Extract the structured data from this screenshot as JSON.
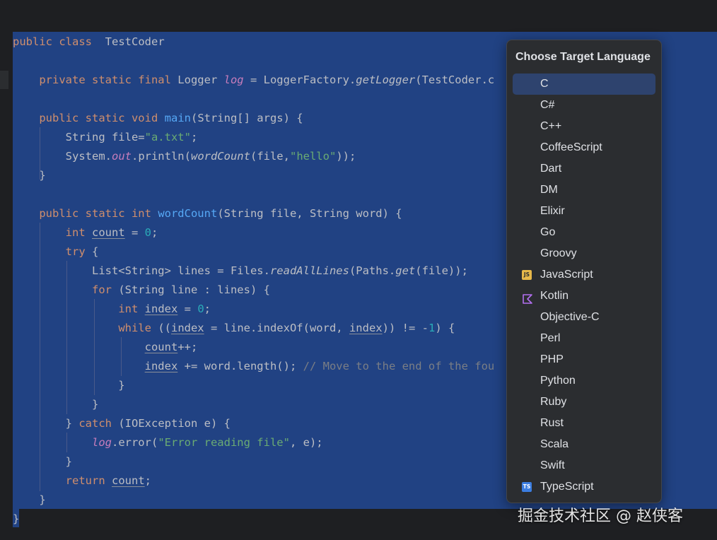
{
  "editor": {
    "code_lines": [
      "public class TestCoder {",
      "",
      "    private static final Logger log = LoggerFactory.getLogger(TestCoder.c",
      "",
      "    public static void main(String[] args) {",
      "        String file=\"a.txt\";",
      "        System.out.println(wordCount(file,\"hello\"));",
      "    }",
      "",
      "    public static int wordCount(String file, String word) {",
      "        int count = 0;",
      "        try {",
      "            List<String> lines = Files.readAllLines(Paths.get(file));",
      "            for (String line : lines) {",
      "                int index = 0;",
      "                while ((index = line.indexOf(word, index)) != -1) {",
      "                    count++;",
      "                    index += word.length(); // Move to the end of the fou",
      "                }",
      "            }",
      "        } catch (IOException e) {",
      "            log.error(\"Error reading file\", e);",
      "        }",
      "        return count;",
      "    }",
      "}"
    ]
  },
  "popup": {
    "title": "Choose Target Language",
    "selected_index": 0,
    "languages": [
      {
        "label": "C",
        "icon": ""
      },
      {
        "label": "C#",
        "icon": ""
      },
      {
        "label": "C++",
        "icon": ""
      },
      {
        "label": "CoffeeScript",
        "icon": ""
      },
      {
        "label": "Dart",
        "icon": ""
      },
      {
        "label": "DM",
        "icon": ""
      },
      {
        "label": "Elixir",
        "icon": ""
      },
      {
        "label": "Go",
        "icon": ""
      },
      {
        "label": "Groovy",
        "icon": ""
      },
      {
        "label": "JavaScript",
        "icon": "javascript-icon",
        "badge": "JS"
      },
      {
        "label": "Kotlin",
        "icon": "kotlin-icon"
      },
      {
        "label": "Objective-C",
        "icon": ""
      },
      {
        "label": "Perl",
        "icon": ""
      },
      {
        "label": "PHP",
        "icon": ""
      },
      {
        "label": "Python",
        "icon": ""
      },
      {
        "label": "Ruby",
        "icon": ""
      },
      {
        "label": "Rust",
        "icon": ""
      },
      {
        "label": "Scala",
        "icon": ""
      },
      {
        "label": "Swift",
        "icon": ""
      },
      {
        "label": "TypeScript",
        "icon": "typescript-icon",
        "badge": "TS"
      }
    ]
  },
  "watermark": "掘金技术社区 @ 赵侠客",
  "colors": {
    "editor_background": "#1e1f22",
    "selection": "#214283",
    "popup_background": "#2b2d30",
    "popup_selected": "#2e436e",
    "keyword": "#cf8e6d",
    "function": "#56a8f5",
    "string": "#6aab73",
    "number": "#2aacb8",
    "static_field": "#c77dbb",
    "comment": "#7a7e85"
  }
}
